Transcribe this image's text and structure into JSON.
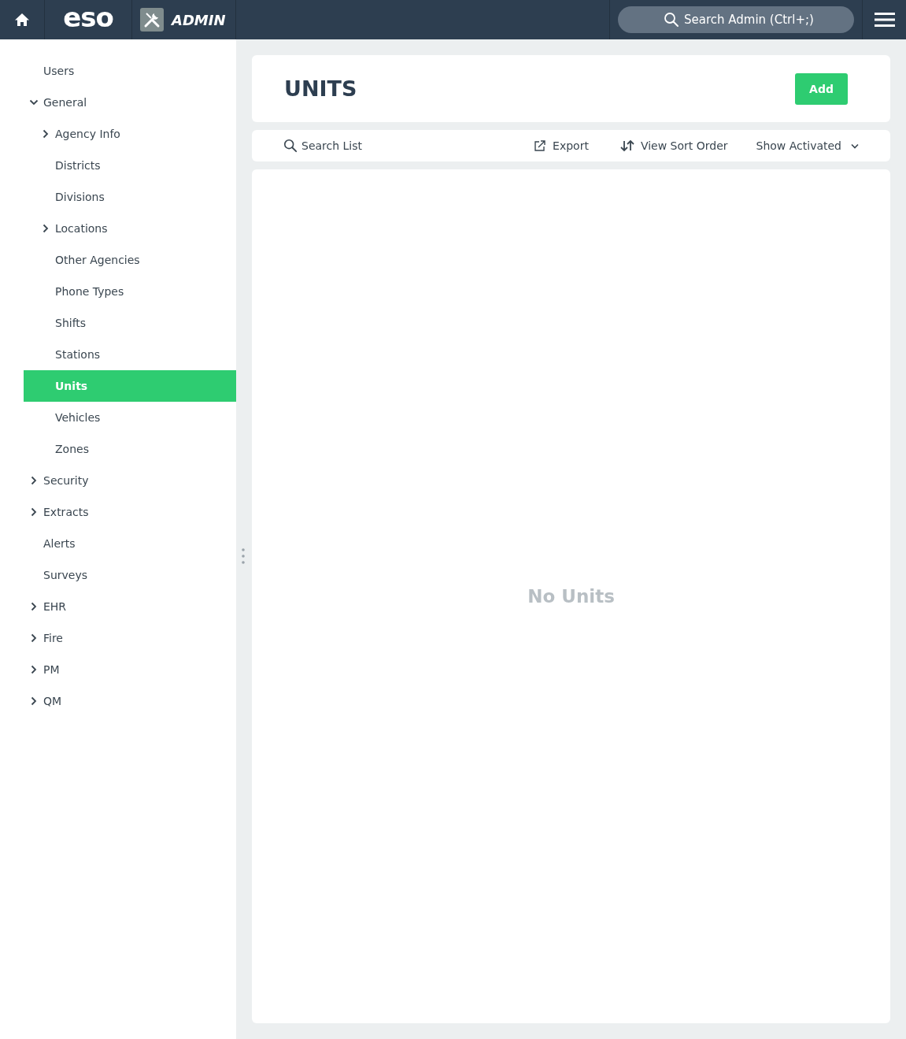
{
  "topbar": {
    "logo": "eso",
    "app_name": "ADMIN",
    "search": {
      "placeholder": "Search Admin (Ctrl+;)"
    }
  },
  "sidebar": {
    "items": [
      {
        "label": "Users",
        "kind": "leaf",
        "selected": false
      },
      {
        "label": "General",
        "kind": "group",
        "expanded": true,
        "selected": false,
        "children": [
          {
            "label": "Agency Info",
            "kind": "group",
            "expanded": false,
            "selected": false
          },
          {
            "label": "Districts",
            "kind": "leaf",
            "selected": false
          },
          {
            "label": "Divisions",
            "kind": "leaf",
            "selected": false
          },
          {
            "label": "Locations",
            "kind": "group",
            "expanded": false,
            "selected": false
          },
          {
            "label": "Other Agencies",
            "kind": "leaf",
            "selected": false
          },
          {
            "label": "Phone Types",
            "kind": "leaf",
            "selected": false
          },
          {
            "label": "Shifts",
            "kind": "leaf",
            "selected": false
          },
          {
            "label": "Stations",
            "kind": "leaf",
            "selected": false
          },
          {
            "label": "Units",
            "kind": "leaf",
            "selected": true
          },
          {
            "label": "Vehicles",
            "kind": "leaf",
            "selected": false
          },
          {
            "label": "Zones",
            "kind": "leaf",
            "selected": false
          }
        ]
      },
      {
        "label": "Security",
        "kind": "group",
        "expanded": false,
        "selected": false
      },
      {
        "label": "Extracts",
        "kind": "group",
        "expanded": false,
        "selected": false
      },
      {
        "label": "Alerts",
        "kind": "leaf",
        "selected": false
      },
      {
        "label": "Surveys",
        "kind": "leaf",
        "selected": false
      },
      {
        "label": "EHR",
        "kind": "group",
        "expanded": false,
        "selected": false
      },
      {
        "label": "Fire",
        "kind": "group",
        "expanded": false,
        "selected": false
      },
      {
        "label": "PM",
        "kind": "group",
        "expanded": false,
        "selected": false
      },
      {
        "label": "QM",
        "kind": "group",
        "expanded": false,
        "selected": false
      }
    ]
  },
  "page": {
    "title": "UNITS",
    "add_button": "Add",
    "toolbar": {
      "search": {
        "placeholder": "Search List"
      },
      "export": "Export",
      "sort": "View Sort Order",
      "filter": "Show Activated"
    },
    "empty_message": "No Units"
  }
}
